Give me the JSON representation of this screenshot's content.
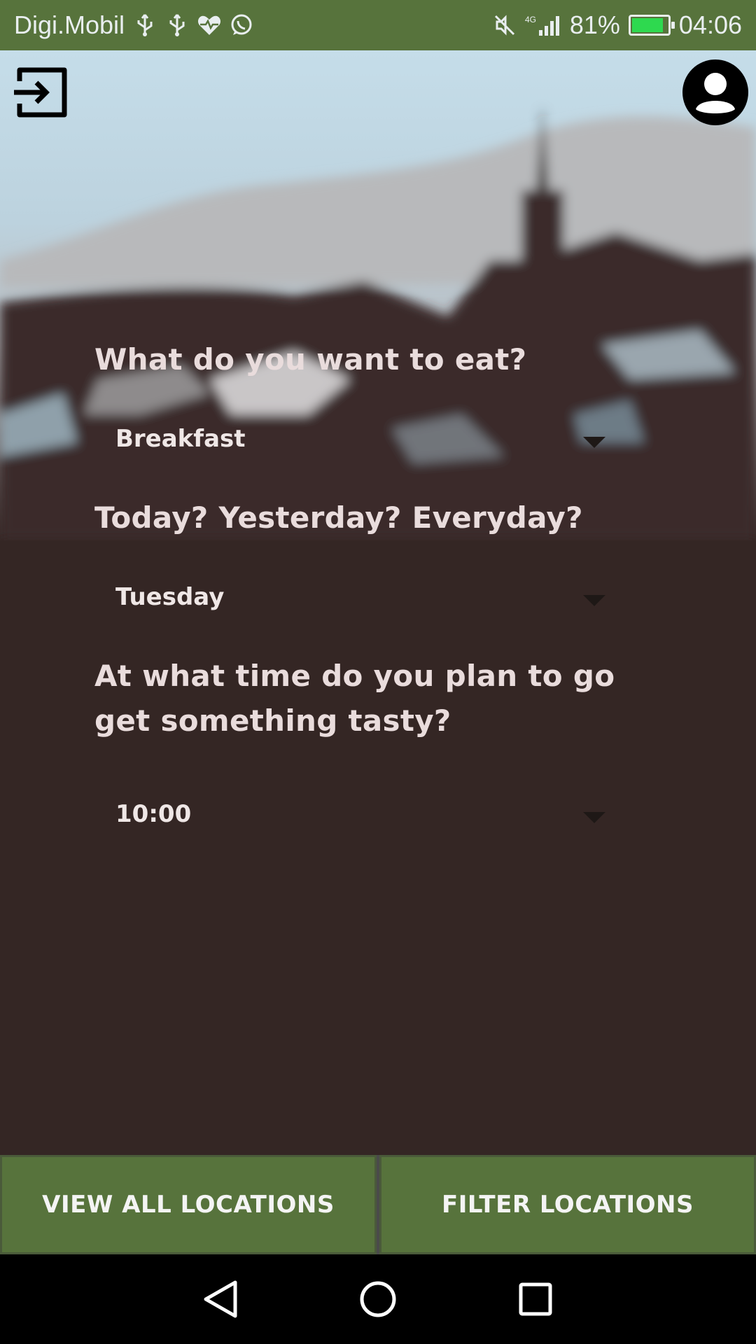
{
  "status_bar": {
    "carrier": "Digi.Mobil",
    "network_label": "4G",
    "battery_percent": "81%",
    "battery_level": 0.81,
    "time": "04:06",
    "icons": [
      "usb-icon",
      "usb-icon",
      "heart-rate-icon",
      "whatsapp-icon",
      "mute-icon",
      "signal-icon",
      "battery-charging-icon"
    ]
  },
  "header": {
    "logout_icon": "logout-icon",
    "profile_icon": "profile-avatar-icon"
  },
  "form": {
    "meal_question": "What do you want to eat?",
    "meal_value": "Breakfast",
    "day_question": "Today? Yesterday? Everyday?",
    "day_value": "Tuesday",
    "time_question": "At what time do you plan to go get something tasty?",
    "time_value": "10:00"
  },
  "actions": {
    "view_all_label": "VIEW ALL LOCATIONS",
    "filter_label": "FILTER LOCATIONS"
  },
  "colors": {
    "accent_green": "#57733c",
    "background_dark": "#342624",
    "text_light": "#e9dcdc"
  }
}
